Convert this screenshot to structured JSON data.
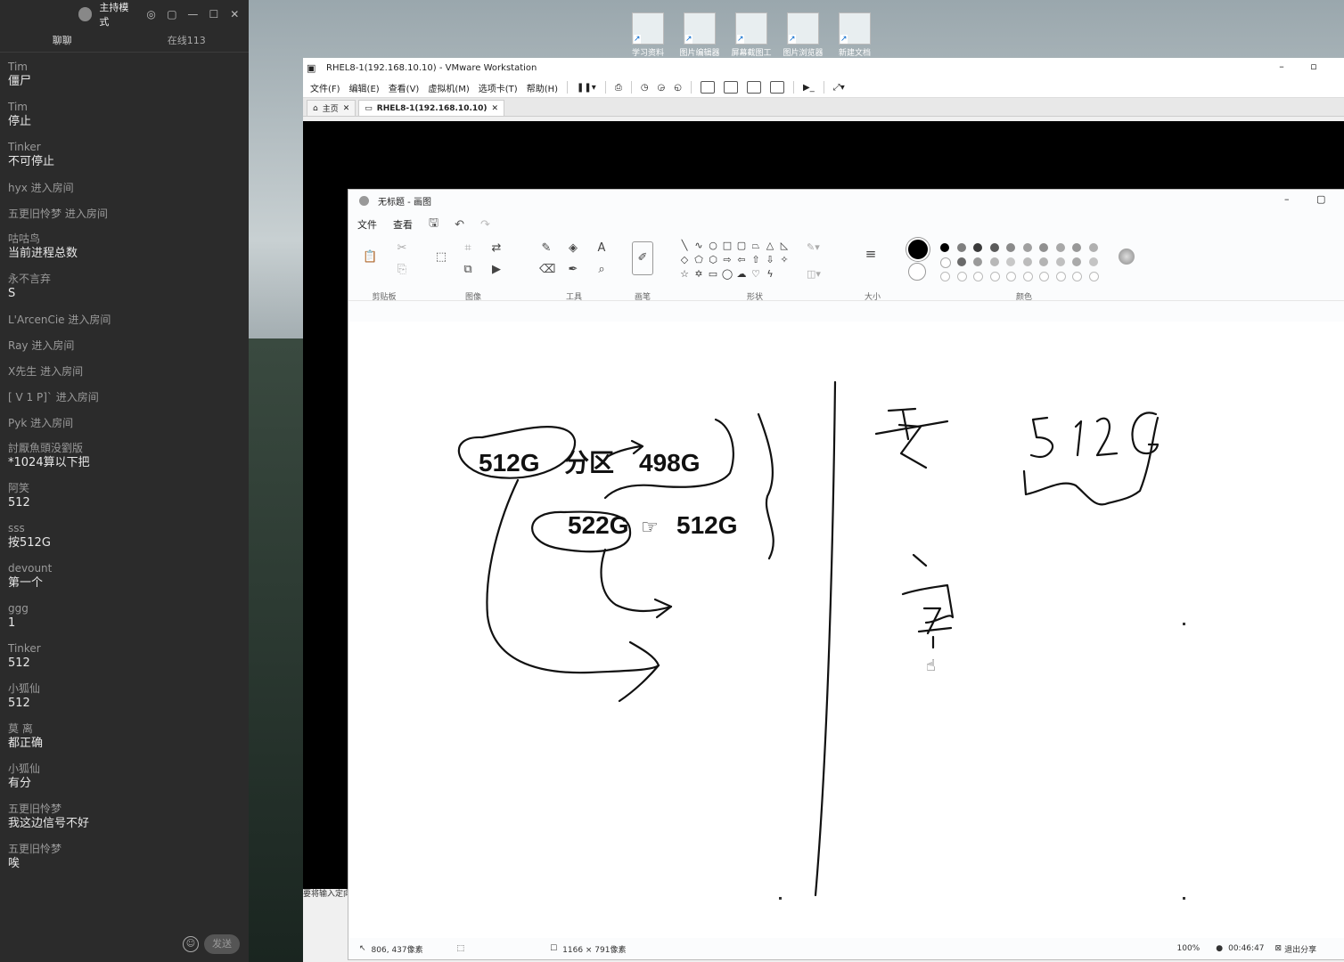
{
  "chat": {
    "title": "主持模式",
    "tabs": [
      "聊聊",
      "在线113"
    ],
    "messages": [
      {
        "name": "Tim",
        "text": "僵尸"
      },
      {
        "name": "Tim",
        "text": "停止"
      },
      {
        "name": "Tinker",
        "text": "不可停止"
      },
      {
        "name": "hyx",
        "text": "进入房间",
        "system": true
      },
      {
        "name": "五更旧怜梦",
        "text": "进入房间",
        "system": true
      },
      {
        "name": "咕咕鸟",
        "text": "当前进程总数"
      },
      {
        "name": "永不言弃",
        "text": "S"
      },
      {
        "name": "L'ArcenCie",
        "text": "进入房间",
        "system": true
      },
      {
        "name": "Ray",
        "text": "进入房间",
        "system": true
      },
      {
        "name": "X先生",
        "text": "进入房间",
        "system": true
      },
      {
        "name": "[ V 1 P]`",
        "text": "进入房间",
        "system": true
      },
      {
        "name": "Pyk",
        "text": "进入房间",
        "system": true
      },
      {
        "name": "討厭魚頭没劉版",
        "text": "*1024算以下把"
      },
      {
        "name": "阿笑",
        "text": "512"
      },
      {
        "name": "sss",
        "text": "按512G"
      },
      {
        "name": "devount",
        "text": "第一个"
      },
      {
        "name": "ggg",
        "text": "1"
      },
      {
        "name": "Tinker",
        "text": "512"
      },
      {
        "name": "小狐仙",
        "text": "512"
      },
      {
        "name": "莫 离",
        "text": "都正确"
      },
      {
        "name": "小狐仙",
        "text": "有分"
      },
      {
        "name": "五更旧怜梦",
        "text": "我这边信号不好"
      },
      {
        "name": "五更旧怜梦",
        "text": "唉"
      }
    ],
    "send_label": "发送"
  },
  "desktop_icons": [
    "学习资料",
    "图片编辑器",
    "屏幕截图工具",
    "图片浏览器",
    "新建文档"
  ],
  "vmware": {
    "title": "RHEL8-1(192.168.10.10) - VMware Workstation",
    "menus": [
      "文件(F)",
      "编辑(E)",
      "查看(V)",
      "虚拟机(M)",
      "选项卡(T)",
      "帮助(H)"
    ],
    "tabs": [
      "主页",
      "RHEL8-1(192.168.10.10)"
    ],
    "status_text": "要将输入定向"
  },
  "paint": {
    "title": "无标题 - 画图",
    "menus": [
      "文件",
      "查看"
    ],
    "groups": [
      "剪贴板",
      "图像",
      "工具",
      "画笔",
      "形状",
      "大小",
      "颜色"
    ],
    "colors": {
      "row1": [
        "#000000",
        "#7f7f7f",
        "#3a3a3a",
        "#5a5a5a",
        "#8a8a8a",
        "#a0a0a0",
        "#909090",
        "#a8a8a8",
        "#989898",
        "#b0b0b0"
      ],
      "row2": [
        "#ffffff",
        "#6a6a6a",
        "#9a9a9a",
        "#b8b8b8",
        "#c8c8c8",
        "#bcbcbc",
        "#b4b4b4",
        "#c0c0c0",
        "#aaaaaa",
        "#c4c4c4"
      ]
    },
    "canvas_text": [
      "512G",
      "分区",
      "498G",
      "522G",
      "512G"
    ],
    "status": {
      "cursor": "806, 437像素",
      "size": "1166 × 791像素",
      "zoom": "100%",
      "timer": "00:46:47",
      "exit_share": "退出分享"
    }
  }
}
